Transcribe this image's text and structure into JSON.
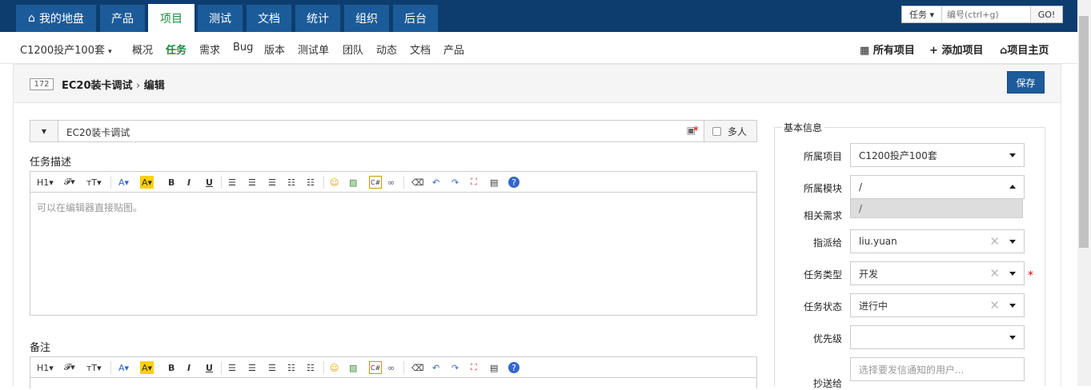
{
  "nav": {
    "tabs": [
      "我的地盘",
      "产品",
      "项目",
      "测试",
      "文档",
      "统计",
      "组织",
      "后台"
    ],
    "active": "项目",
    "search": {
      "type": "任务",
      "placeholder": "编号(ctrl+g)",
      "go": "GO!"
    }
  },
  "subnav": {
    "project": "C1200投产100套",
    "items": [
      "概况",
      "任务",
      "需求",
      "Bug",
      "版本",
      "测试单",
      "团队",
      "动态",
      "文档",
      "产品"
    ],
    "active": "任务",
    "right": [
      "所有项目",
      "添加项目",
      "项目主页"
    ]
  },
  "header": {
    "id": "172",
    "title": "EC20装卡调试",
    "sep": "›",
    "action": "编辑",
    "save": "保存"
  },
  "form": {
    "name": "EC20装卡调试",
    "multi": "多人",
    "desc_label": "任务描述",
    "desc_placeholder": "可以在编辑器直接贴图。",
    "note_label": "备注"
  },
  "toolbar": {
    "h1": "H1▾",
    "font": "𝓕▾",
    "size": "тT▾",
    "color": "A▾",
    "bg": "A▾",
    "b": "B",
    "i": "I",
    "u": "U"
  },
  "side": {
    "legend": "基本信息",
    "fields": [
      {
        "label": "所属项目",
        "value": "C1200投产100套"
      },
      {
        "label": "所属模块",
        "value": "/"
      },
      {
        "label": "相关需求",
        "value": ""
      },
      {
        "label": "指派给",
        "value": "liu.yuan"
      },
      {
        "label": "任务类型",
        "value": "开发"
      },
      {
        "label": "任务状态",
        "value": "进行中"
      },
      {
        "label": "优先级",
        "value": ""
      },
      {
        "label": "抄送给",
        "value": ""
      }
    ],
    "dropdown_option": "/",
    "cc_placeholder": "选择要发信通知的用户..."
  }
}
